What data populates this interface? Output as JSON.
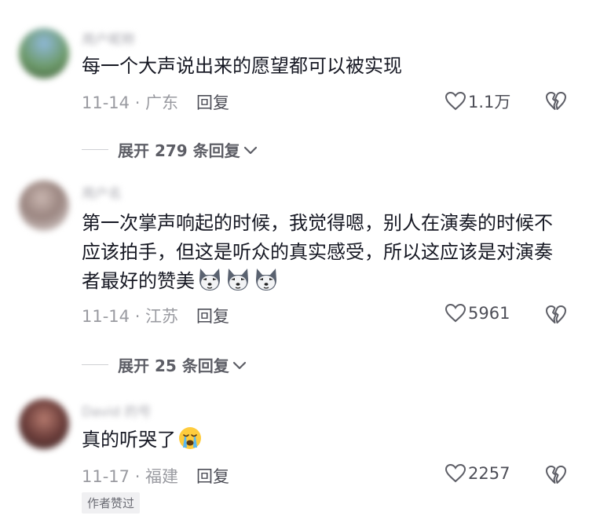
{
  "comments": [
    {
      "username": "用户昵称",
      "text": "每一个大声说出来的愿望都可以被实现",
      "meta": "11-14 · 广东",
      "reply_label": "回复",
      "likes": "1.1万",
      "expand_label": "展开 279 条回复"
    },
    {
      "username": "用户名",
      "text": "第一次掌声响起的时候，我觉得嗯，别人在演奏的时候不应该拍手，但这是听众的真实感受，所以这应该是对演奏者最好的赞美",
      "meta": "11-14 · 江苏",
      "reply_label": "回复",
      "likes": "5961",
      "expand_label": "展开 25 条回复"
    },
    {
      "username": "David 的号",
      "text": "真的听哭了",
      "meta": "11-17 · 福建",
      "reply_label": "回复",
      "likes": "2257",
      "author_badge": "作者赞过"
    }
  ],
  "icons": {
    "like": "heart-outline-icon",
    "dislike": "broken-heart-icon",
    "expand": "chevron-down-icon",
    "emoji_dog": "husky-emoji",
    "emoji_cry": "crying-face-emoji"
  },
  "colors": {
    "text_primary": "#161823",
    "text_secondary": "#9a9ba1",
    "action": "#4d4e57",
    "badge_bg": "#f0f0f2"
  }
}
